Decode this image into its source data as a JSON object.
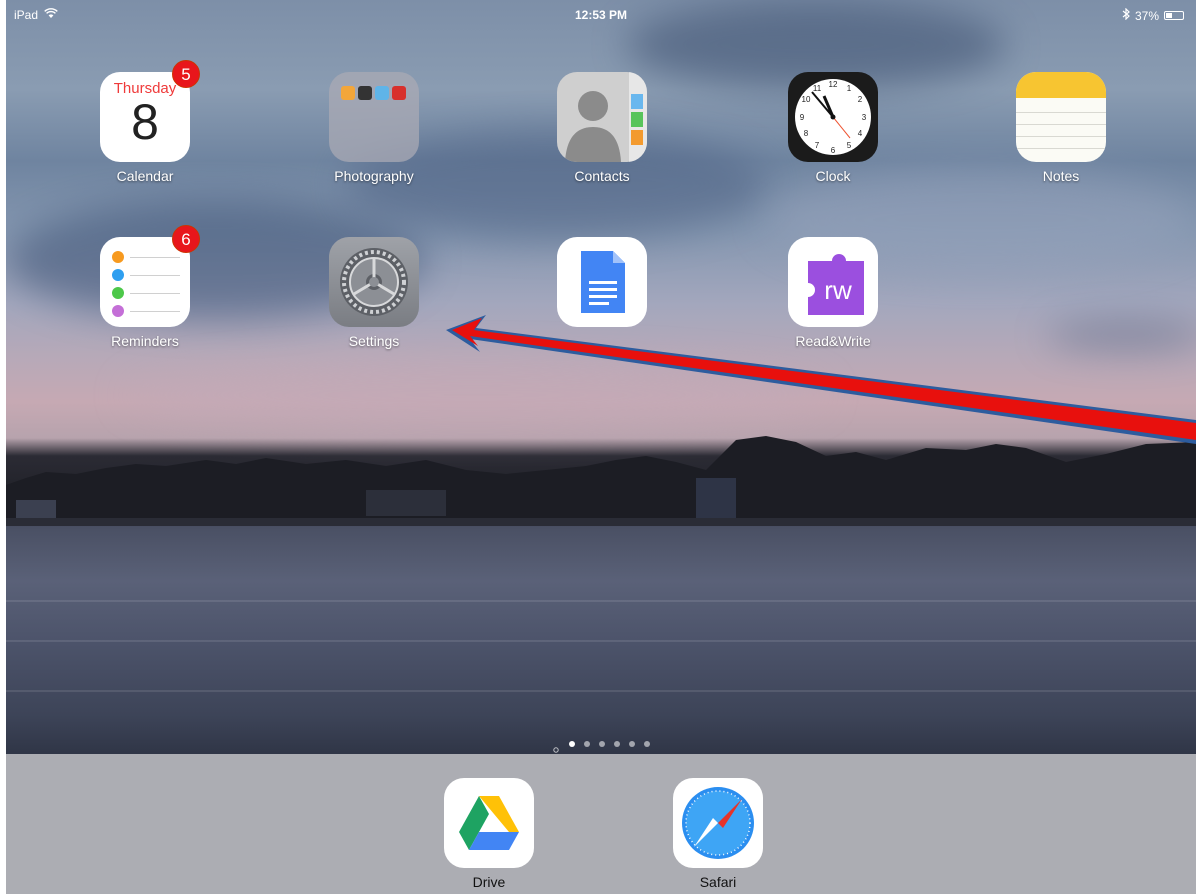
{
  "status_bar": {
    "device": "iPad",
    "time": "12:53 PM",
    "battery": "37%",
    "battery_level": 0.37
  },
  "home_apps": [
    {
      "label": "Calendar",
      "day": "Thursday",
      "date": "8",
      "badge": "5"
    },
    {
      "label": "Photography"
    },
    {
      "label": "Contacts"
    },
    {
      "label": "Clock"
    },
    {
      "label": "Notes"
    },
    {
      "label": "Reminders",
      "badge": "6"
    },
    {
      "label": "Settings"
    },
    {
      "label": ""
    },
    {
      "label": "Read&Write",
      "glyph": "rw"
    }
  ],
  "page_dots": {
    "count": 6,
    "active_index": 0
  },
  "dock_apps": [
    {
      "label": "Drive"
    },
    {
      "label": "Safari"
    }
  ],
  "annotation": {
    "color": "#e8100d",
    "outline": "#2d5c9e",
    "points_to": "Settings"
  }
}
